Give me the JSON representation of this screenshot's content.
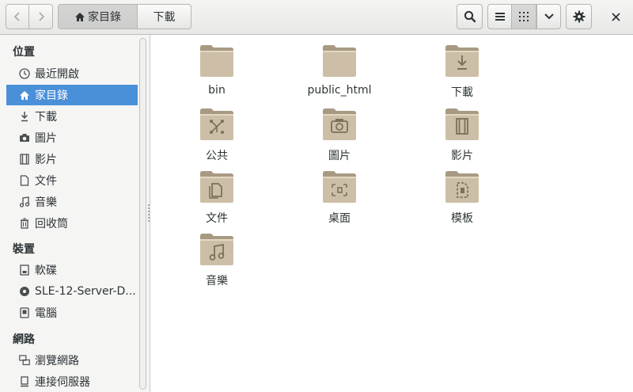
{
  "header": {
    "path": [
      "家目錄",
      "下載"
    ],
    "path_home_label": "家目錄",
    "path_download_label": "下載",
    "icons": {
      "back": "back-arrow-icon",
      "forward": "forward-arrow-icon",
      "search": "search-icon",
      "list_view": "list-view-icon",
      "grid_view": "grid-view-icon",
      "menu": "chevron-down-icon",
      "settings": "gear-icon",
      "close": "close-icon"
    }
  },
  "sidebar": {
    "sections": [
      {
        "title": "位置",
        "items": [
          {
            "label": "最近開啟",
            "icon": "clock-icon"
          },
          {
            "label": "家目錄",
            "icon": "home-icon",
            "selected": true
          },
          {
            "label": "下載",
            "icon": "download-icon"
          },
          {
            "label": "圖片",
            "icon": "camera-icon"
          },
          {
            "label": "影片",
            "icon": "film-icon"
          },
          {
            "label": "文件",
            "icon": "document-icon"
          },
          {
            "label": "音樂",
            "icon": "music-icon"
          },
          {
            "label": "回收筒",
            "icon": "trash-icon"
          }
        ]
      },
      {
        "title": "裝置",
        "items": [
          {
            "label": "軟碟",
            "icon": "drive-icon"
          },
          {
            "label": "SLE-12-Server-D...",
            "icon": "disc-icon"
          },
          {
            "label": "電腦",
            "icon": "computer-icon"
          }
        ]
      },
      {
        "title": "網路",
        "items": [
          {
            "label": "瀏覽網路",
            "icon": "network-icon"
          },
          {
            "label": "連接伺服器",
            "icon": "server-icon"
          }
        ]
      }
    ]
  },
  "files": [
    {
      "name": "bin",
      "emblem": "none"
    },
    {
      "name": "public_html",
      "emblem": "none"
    },
    {
      "name": "下載",
      "emblem": "download"
    },
    {
      "name": "公共",
      "emblem": "share"
    },
    {
      "name": "圖片",
      "emblem": "camera"
    },
    {
      "name": "影片",
      "emblem": "film"
    },
    {
      "name": "文件",
      "emblem": "document"
    },
    {
      "name": "桌面",
      "emblem": "desktop"
    },
    {
      "name": "模板",
      "emblem": "template"
    },
    {
      "name": "音樂",
      "emblem": "music"
    }
  ],
  "colors": {
    "selection": "#4a90d9",
    "folder_body": "#cdbfa7",
    "folder_dark": "#a89a82",
    "folder_emblem": "#7d705c"
  }
}
